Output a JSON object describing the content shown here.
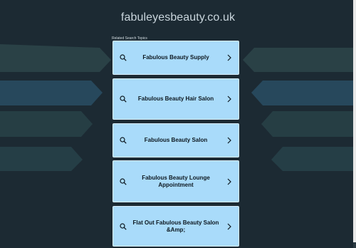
{
  "site": {
    "domain": "fabuleyesbeauty.co.uk"
  },
  "related": {
    "heading": "Related Search Topics",
    "items": [
      {
        "label": "Fabulous Beauty Supply"
      },
      {
        "label": "Fabulous Beauty Hair Salon"
      },
      {
        "label": "Fabulous Beauty Salon"
      },
      {
        "label": "Fabulous Beauty Lounge Appointment"
      },
      {
        "label": "Flat Out Fabulous Beauty Salon &Amp;"
      }
    ]
  },
  "icons": {
    "search": "search-icon",
    "chevron": "chevron-right-icon"
  },
  "colors": {
    "background": "#1c2a33",
    "card": "#a9dbfa",
    "card_text": "#0d1820"
  }
}
